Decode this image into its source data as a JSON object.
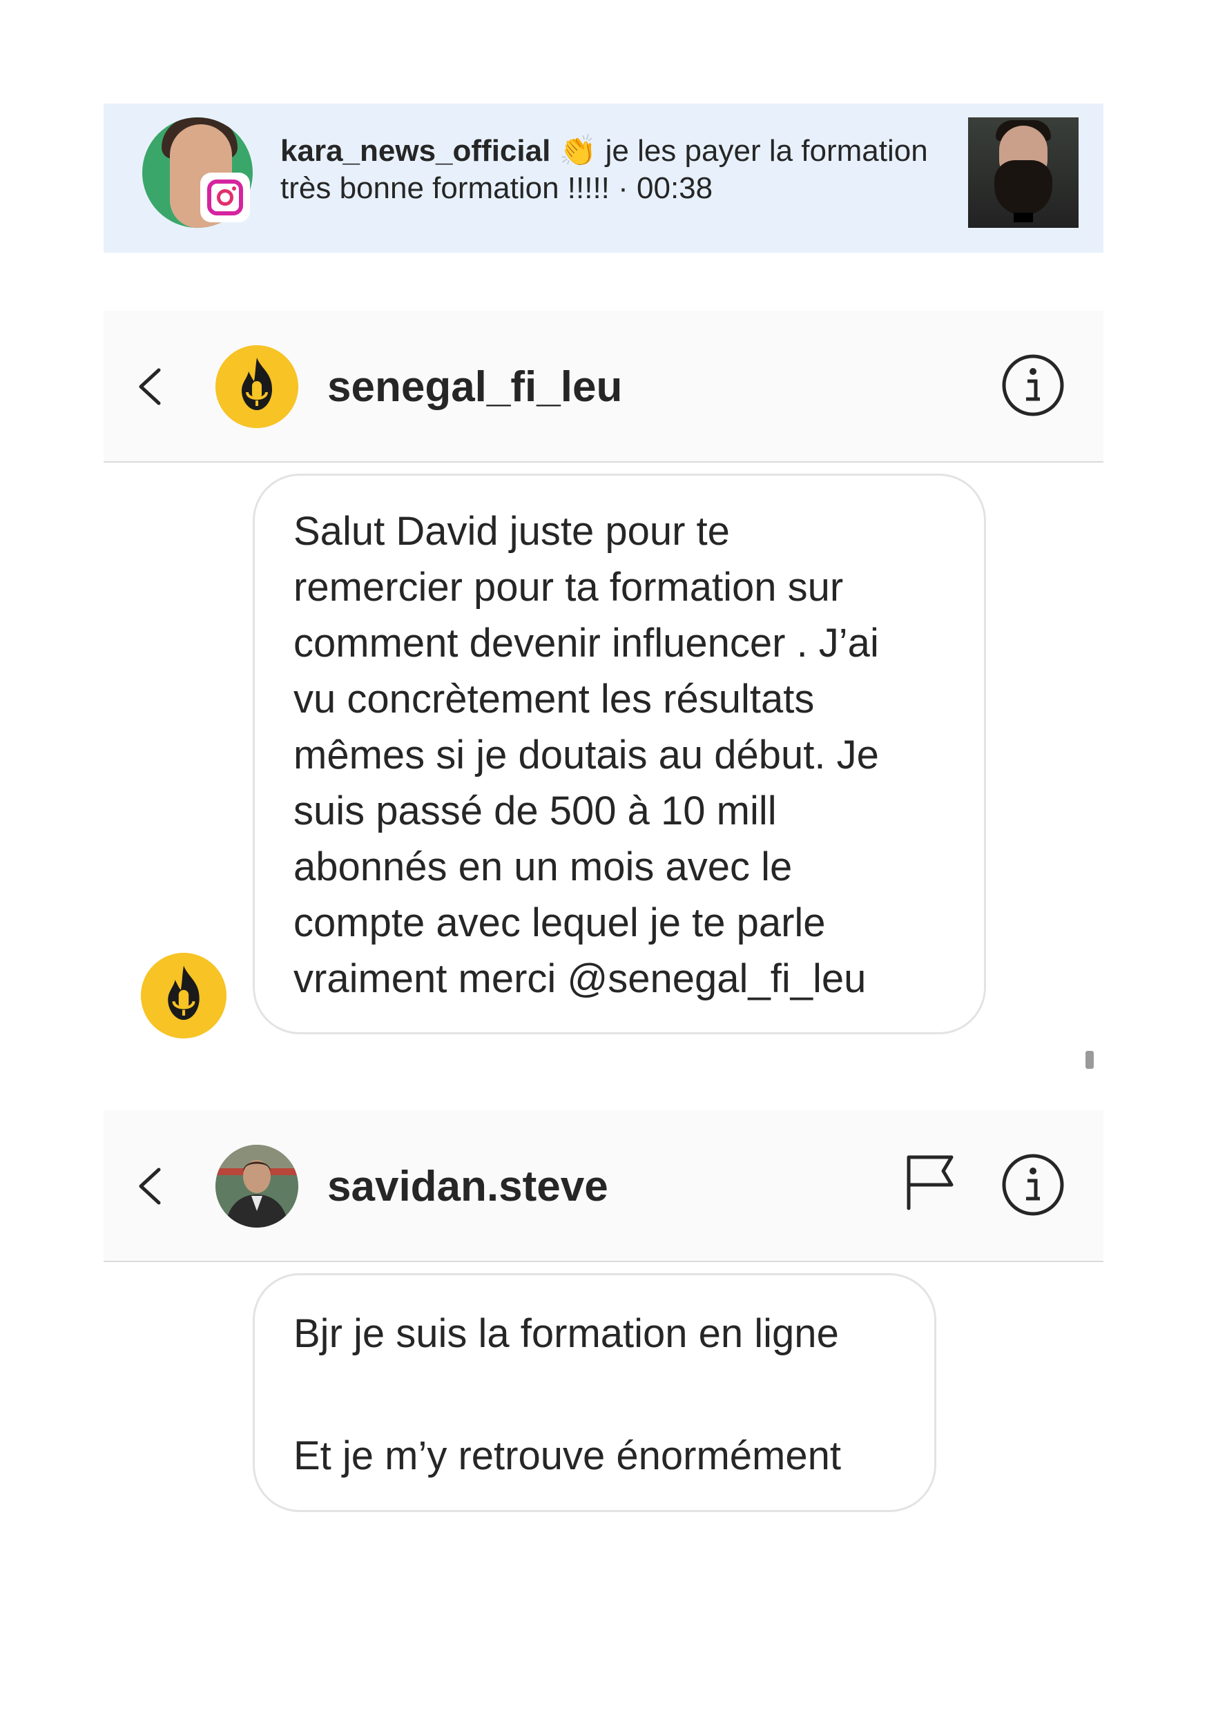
{
  "notification": {
    "username": "kara_news_official",
    "emoji": "👏",
    "message_line1": "je les payer la formation",
    "message_line2": "très bonne formation !!!!! · 00:38",
    "badge_icon": "instagram-icon"
  },
  "chat1": {
    "username": "senegal_fi_leu",
    "back_icon": "chevron-left-icon",
    "info_icon": "info-circle-icon",
    "message_lines": [
      "Salut David juste pour te",
      "remercier pour ta formation sur",
      "comment devenir influencer . J’ai",
      "vu concrètement les résultats",
      "mêmes si je doutais au début. Je",
      "suis passé de 500 à 10 mill",
      "abonnés en un mois avec le",
      "compte avec lequel je te parle",
      "vraiment merci @senegal_fi_leu"
    ]
  },
  "chat2": {
    "username": "savidan.steve",
    "back_icon": "chevron-left-icon",
    "flag_icon": "flag-icon",
    "info_icon": "info-circle-icon",
    "message_line1": "Bjr je suis la formation en ligne",
    "message_line2": "Et je m’y retrouve énormément"
  },
  "colors": {
    "notification_bg": "#e8f1fb",
    "header_bg": "#fafafa",
    "avatar_yellow": "#f7c325",
    "text": "#262626",
    "bubble_border": "#e3e3e3"
  }
}
